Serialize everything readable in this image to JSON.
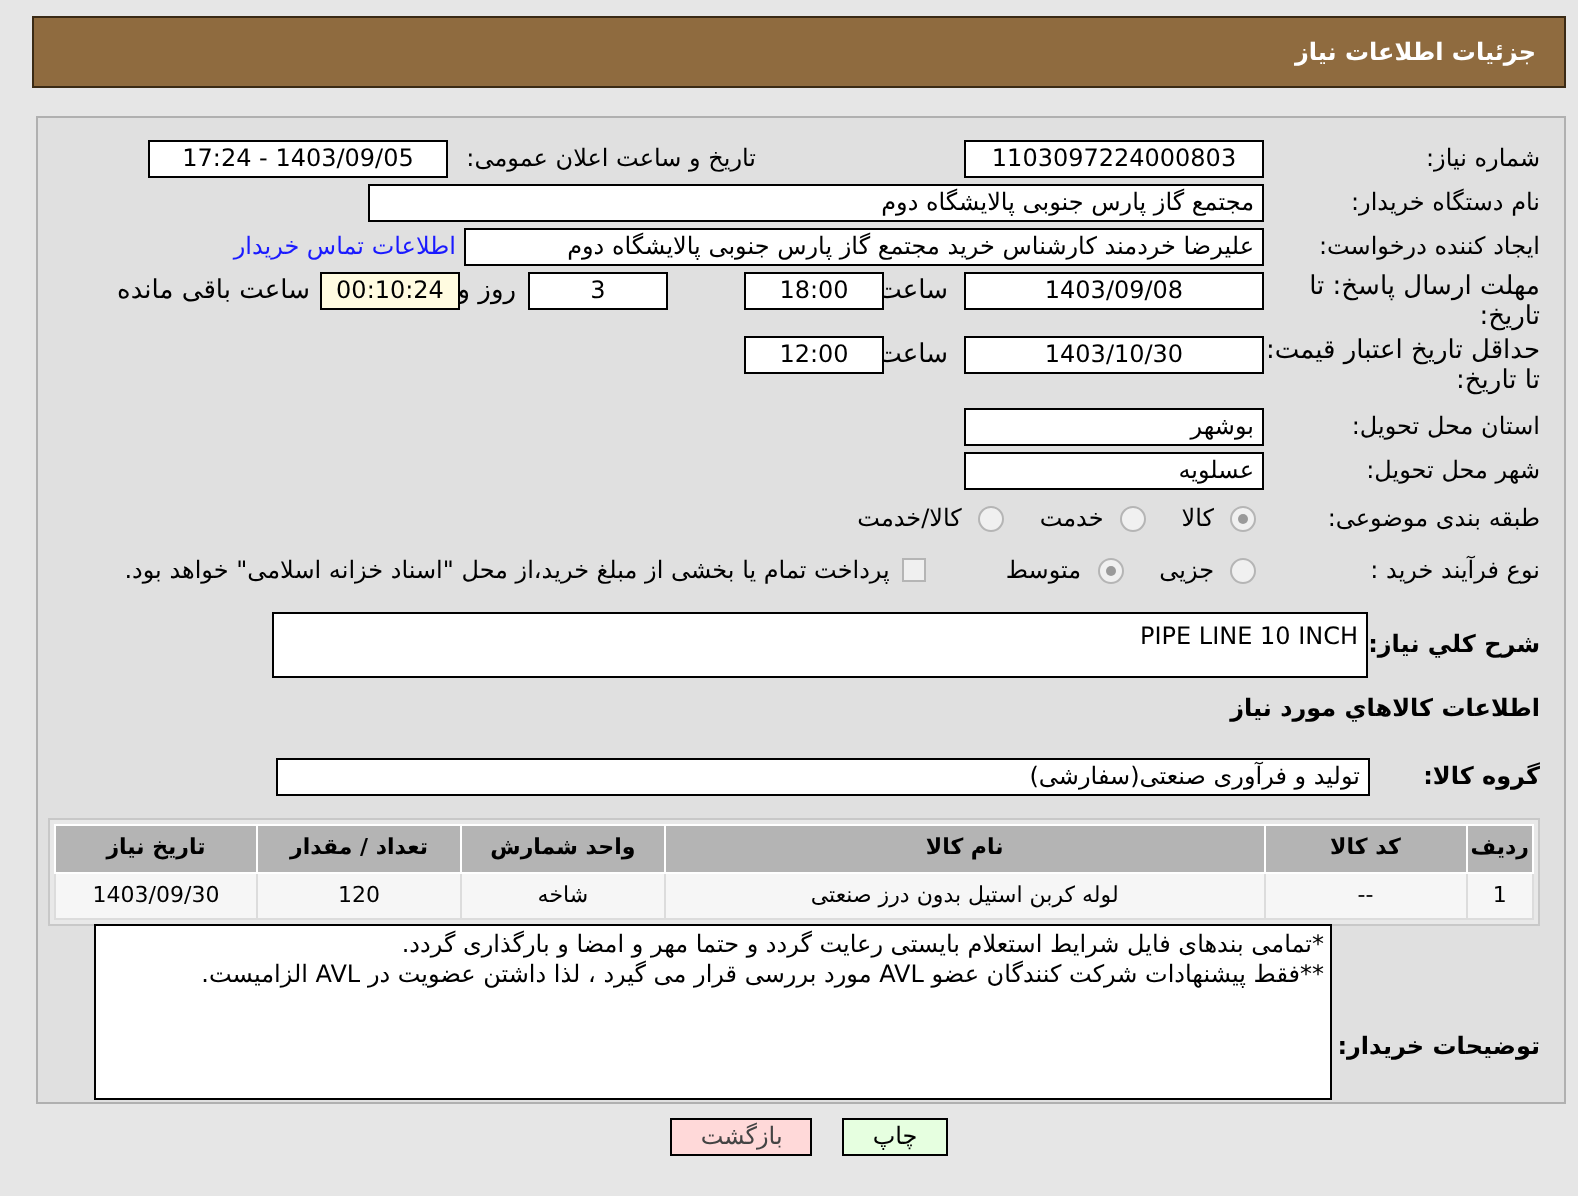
{
  "header": {
    "title": "جزئیات اطلاعات نیاز"
  },
  "need_number": {
    "label": "شماره نیاز:",
    "value": "1103097224000803"
  },
  "announce": {
    "label": "تاریخ و ساعت اعلان عمومی:",
    "value": "1403/09/05 - 17:24"
  },
  "buyer_org": {
    "label": "نام دستگاه خریدار:",
    "value": "مجتمع گاز پارس جنوبی  پالایشگاه دوم"
  },
  "requester": {
    "label": "ایجاد کننده درخواست:",
    "value": "علیرضا خردمند کارشناس خرید مجتمع گاز پارس جنوبی  پالایشگاه دوم",
    "link": "اطلاعات تماس خریدار"
  },
  "reply_deadline": {
    "label": "مهلت ارسال پاسخ: تا تاریخ:",
    "date": "1403/09/08",
    "time_label": "ساعت",
    "time": "18:00",
    "days": "3",
    "days_label": "روز و",
    "remaining": "00:10:24",
    "remaining_label": "ساعت باقی مانده"
  },
  "price_validity": {
    "label": "حداقل تاریخ اعتبار قیمت: تا تاریخ:",
    "date": "1403/10/30",
    "time_label": "ساعت",
    "time": "12:00"
  },
  "province": {
    "label": "استان محل تحویل:",
    "value": "بوشهر"
  },
  "city": {
    "label": "شهر محل تحویل:",
    "value": "عسلویه"
  },
  "category": {
    "label": "طبقه بندی موضوعی:",
    "options": [
      {
        "label": "کالا",
        "selected": true
      },
      {
        "label": "خدمت",
        "selected": false
      },
      {
        "label": "کالا/خدمت",
        "selected": false
      }
    ]
  },
  "process": {
    "label": "نوع فرآیند خرید :",
    "options": [
      {
        "label": "جزیی",
        "selected": false
      },
      {
        "label": "متوسط",
        "selected": true
      }
    ],
    "payment": {
      "label": "پرداخت تمام یا بخشی از مبلغ خرید،از محل \"اسناد خزانه اسلامی\" خواهد بود.",
      "checked": false
    }
  },
  "description": {
    "label": "شرح کلي نیاز:",
    "value": "PIPE LINE 10 INCH"
  },
  "goods_heading": "اطلاعات کالاهاي مورد نیاز",
  "goods_group": {
    "label": "گروه کالا:",
    "value": "تولید و فرآوری صنعتی(سفارشی)"
  },
  "table": {
    "columns": [
      "ردیف",
      "کد کالا",
      "نام کالا",
      "واحد شمارش",
      "تعداد / مقدار",
      "تاریخ نیاز"
    ],
    "rows": [
      [
        "1",
        "--",
        "لوله کربن استیل بدون درز صنعتی",
        "شاخه",
        "120",
        "1403/09/30"
      ]
    ]
  },
  "buyer_notes": {
    "label": "توضیحات خریدار:",
    "lines": [
      "*تمامی بندهای فایل شرایط استعلام بایستی رعایت گردد و حتما مهر و امضا و بارگذاری گردد.",
      "**فقط پیشنهادات شرکت کنندگان عضو AVL مورد بررسی قرار می گیرد ، لذا داشتن عضویت در AVL الزامیست."
    ]
  },
  "buttons": [
    {
      "label": "چاپ",
      "kind": "print"
    },
    {
      "label": "بازگشت",
      "kind": "back"
    }
  ]
}
